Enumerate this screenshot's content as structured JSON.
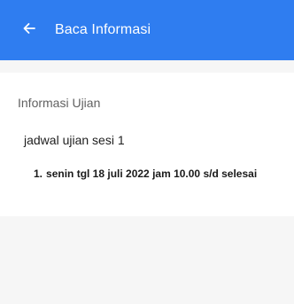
{
  "app_bar": {
    "title": "Baca Informasi",
    "back_icon": "arrow-left-icon",
    "color": "#2f7df0"
  },
  "content": {
    "section_title": "Informasi Ujian",
    "body_text": "jadwal ujian sesi 1",
    "list_items": [
      {
        "number": "1.",
        "text": "senin tgl 18 juli 2022 jam 10.00 s/d selesai"
      }
    ]
  }
}
